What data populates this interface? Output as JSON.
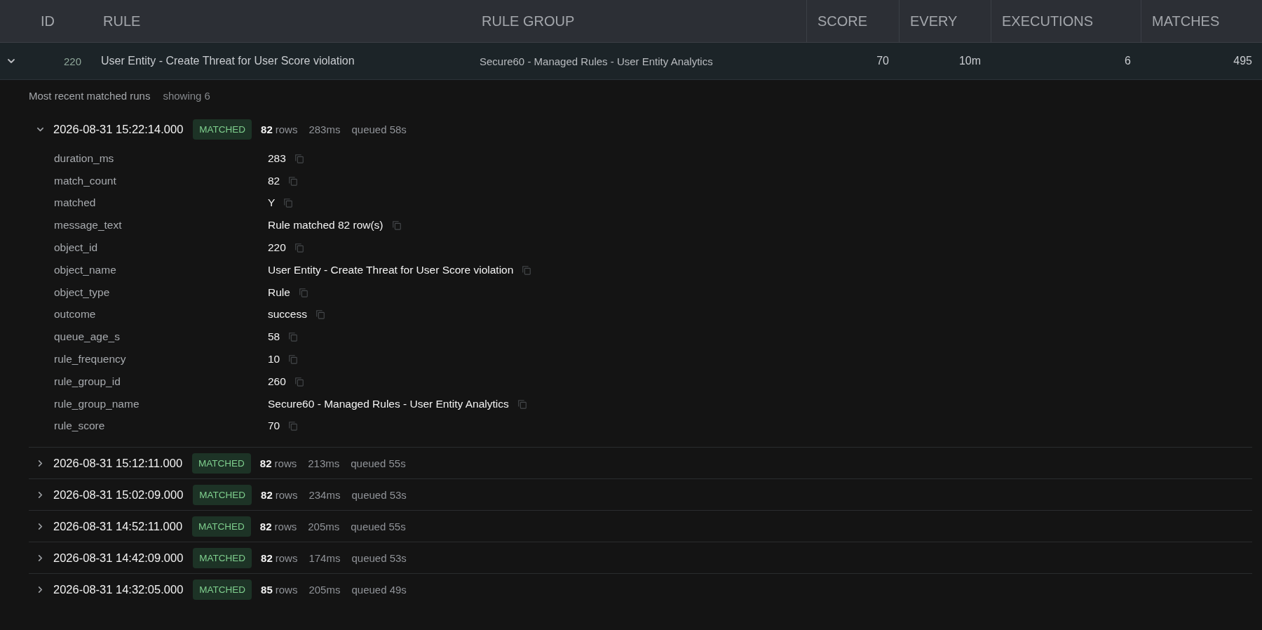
{
  "table": {
    "columns": [
      "ID",
      "RULE",
      "RULE GROUP",
      "SCORE",
      "EVERY",
      "EXECUTIONS",
      "MATCHES"
    ],
    "rows": [
      {
        "expanded": true,
        "id": "220",
        "rule": "User Entity - Create Threat for User Score violation",
        "rule_group": "Secure60 - Managed Rules - User Entity Analytics",
        "score": "70",
        "every": "10m",
        "executions": "6",
        "matches": "495",
        "runs_panel": {
          "title": "Most recent matched runs",
          "count": "showing 6",
          "runs": [
            {
              "expanded": true,
              "timestamp": "2026-08-31 15:22:14.000",
              "status": "MATCHED",
              "row_count": "82",
              "rows_label": "rows",
              "duration": "283ms",
              "queued": "queued 58s",
              "fields": [
                {
                  "key": "duration_ms",
                  "value": "283"
                },
                {
                  "key": "match_count",
                  "value": "82"
                },
                {
                  "key": "matched",
                  "value": "Y"
                },
                {
                  "key": "message_text",
                  "value": "Rule matched 82 row(s)"
                },
                {
                  "key": "object_id",
                  "value": "220"
                },
                {
                  "key": "object_name",
                  "value": "User Entity - Create Threat for User Score violation"
                },
                {
                  "key": "object_type",
                  "value": "Rule"
                },
                {
                  "key": "outcome",
                  "value": "success"
                },
                {
                  "key": "queue_age_s",
                  "value": "58"
                },
                {
                  "key": "rule_frequency",
                  "value": "10"
                },
                {
                  "key": "rule_group_id",
                  "value": "260"
                },
                {
                  "key": "rule_group_name",
                  "value": "Secure60 - Managed Rules - User Entity Analytics"
                },
                {
                  "key": "rule_score",
                  "value": "70"
                }
              ]
            },
            {
              "expanded": false,
              "timestamp": "2026-08-31 15:12:11.000",
              "status": "MATCHED",
              "row_count": "82",
              "rows_label": "rows",
              "duration": "213ms",
              "queued": "queued 55s"
            },
            {
              "expanded": false,
              "timestamp": "2026-08-31 15:02:09.000",
              "status": "MATCHED",
              "row_count": "82",
              "rows_label": "rows",
              "duration": "234ms",
              "queued": "queued 53s"
            },
            {
              "expanded": false,
              "timestamp": "2026-08-31 14:52:11.000",
              "status": "MATCHED",
              "row_count": "82",
              "rows_label": "rows",
              "duration": "205ms",
              "queued": "queued 55s"
            },
            {
              "expanded": false,
              "timestamp": "2026-08-31 14:42:09.000",
              "status": "MATCHED",
              "row_count": "82",
              "rows_label": "rows",
              "duration": "174ms",
              "queued": "queued 53s"
            },
            {
              "expanded": false,
              "timestamp": "2026-08-31 14:32:05.000",
              "status": "MATCHED",
              "row_count": "85",
              "rows_label": "rows",
              "duration": "205ms",
              "queued": "queued 49s"
            }
          ]
        }
      }
    ]
  }
}
